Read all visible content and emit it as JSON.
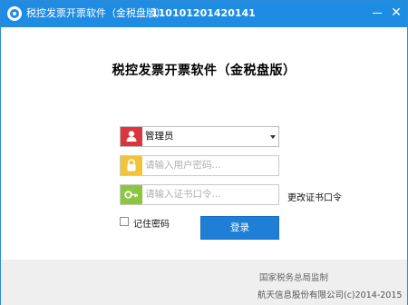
{
  "window": {
    "title": "税控发票开票软件（金税盘版）",
    "title_code": "110101201420141",
    "minimize_label": "",
    "close_label": "✕"
  },
  "heading": "税控发票开票软件（金税盘版）",
  "form": {
    "user_value": "管理员",
    "password_placeholder": "请输入用户密码...",
    "cert_placeholder": "请输入证书口令...",
    "change_cert_label": "更改证书口令",
    "remember_label": "记住密码",
    "remember_checked": false,
    "login_label": "登录"
  },
  "footer": {
    "line1": "国家税务总局监制",
    "line2": "航天信息股份有限公司(c)2014-2015"
  },
  "colors": {
    "titlebar": "#1f8ce3",
    "user_icon_bg": "#d9363e",
    "password_icon_bg": "#f2c338",
    "cert_icon_bg": "#8cc63f",
    "login_button": "#1f7fd6"
  },
  "icons": {
    "app": "app-logo-icon",
    "user": "user-icon",
    "password": "lock-icon",
    "cert": "key-icon",
    "dropdown": "chevron-down-icon"
  }
}
